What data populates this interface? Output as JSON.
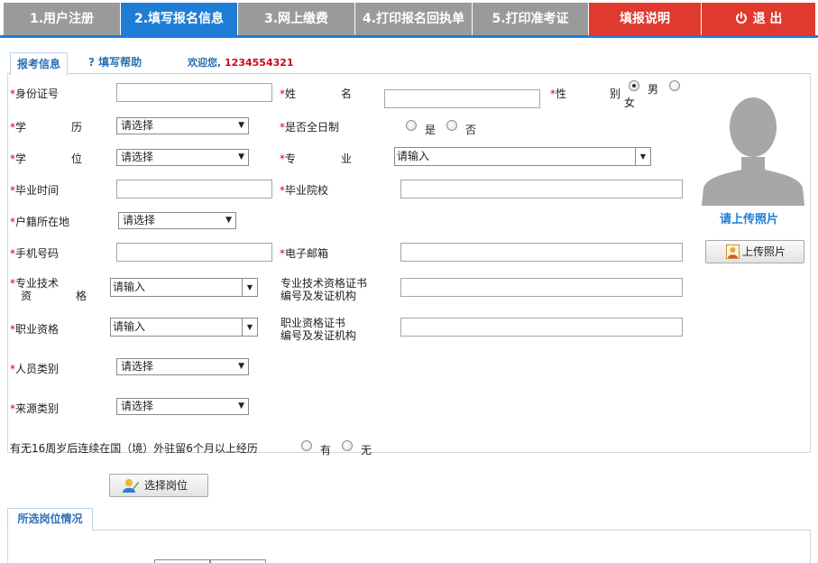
{
  "steps": [
    {
      "label": "1.用户注册"
    },
    {
      "label": "2.填写报名信息"
    },
    {
      "label": "3.网上缴费"
    },
    {
      "label": "4.打印报名回执单"
    },
    {
      "label": "5.打印准考证"
    },
    {
      "label": "填报说明"
    },
    {
      "label": "退 出"
    }
  ],
  "colors": {
    "active_step": "#1e7ed6",
    "inactive_step": "#9a9a9a",
    "action_step": "#e0392d",
    "required": "#d0021b",
    "link": "#2c6fb4"
  },
  "tabs": {
    "info": "报考信息",
    "help": "填写帮助",
    "help_icon": "?",
    "welcome_prefix": "欢迎您,",
    "user_id": "1234554321"
  },
  "required_mark": "*",
  "form": {
    "id_card": "身份证号",
    "name_label": [
      "姓",
      "名"
    ],
    "gender_label": [
      "性",
      "别"
    ],
    "gender_male": "男",
    "gender_female": "女",
    "education": [
      "学",
      "历"
    ],
    "fulltime": "是否全日制",
    "yes": "是",
    "no": "否",
    "degree": [
      "学",
      "位"
    ],
    "major": [
      "专",
      "业"
    ],
    "grad_time": "毕业时间",
    "grad_school": "毕业院校",
    "household": "户籍所在地",
    "phone": "手机号码",
    "email": "电子邮箱",
    "tech_qual_1": "专业技术",
    "tech_qual_2": [
      "资",
      "格"
    ],
    "tech_cert_1": "专业技术资格证书",
    "tech_cert_2": "编号及发证机构",
    "job_qual": "职业资格",
    "job_cert_1": "职业资格证书",
    "job_cert_2": "编号及发证机构",
    "person_type": "人员类别",
    "source_type": "来源类别",
    "abroad": "有无16周岁后连续在国（境）外驻留6个月以上经历",
    "abroad_yes": "有",
    "abroad_no": "无",
    "select_placeholder": "请选择",
    "input_placeholder": "请输入"
  },
  "photo": {
    "title": "请上传照片",
    "upload_label": "上传照片"
  },
  "choose_post_label": "选择岗位",
  "selected_posts_tab": "所选岗位情况",
  "icons": {
    "power": "power-icon",
    "help": "question-icon",
    "avatar": "avatar-silhouette-icon",
    "upload": "person-upload-icon",
    "choose": "edit-user-icon"
  }
}
